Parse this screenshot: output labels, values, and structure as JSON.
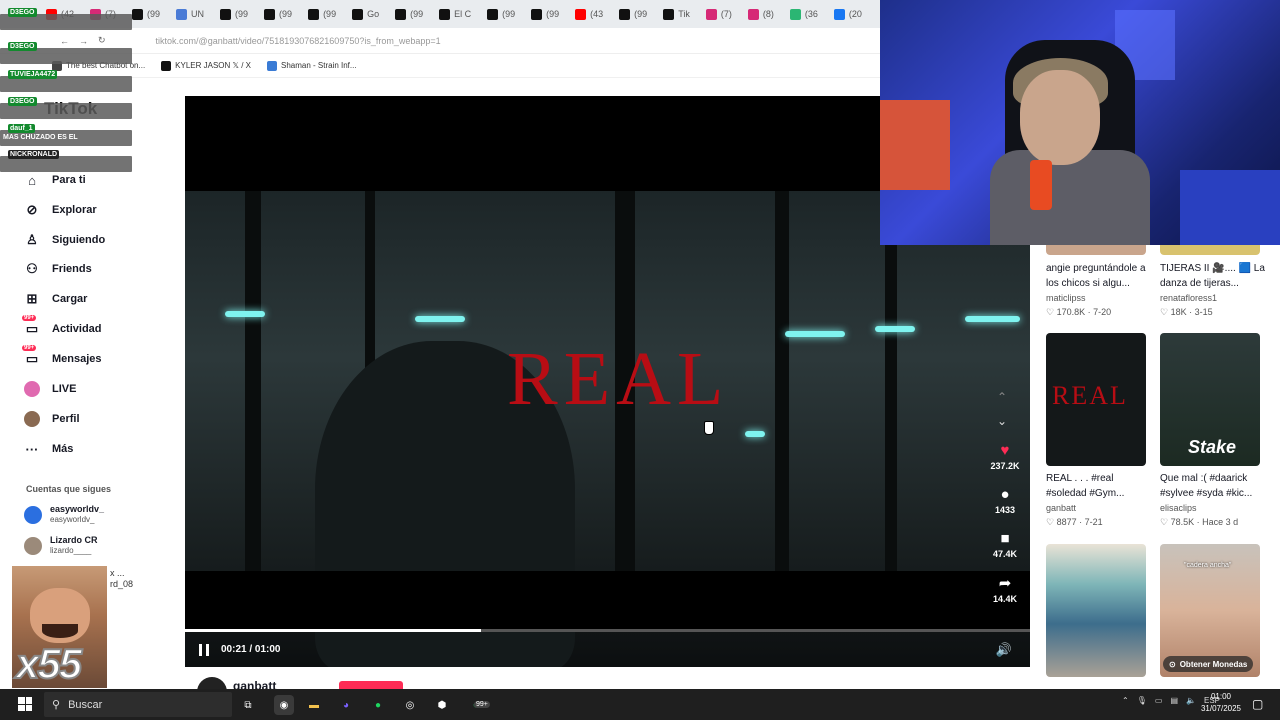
{
  "browser": {
    "tabs": [
      {
        "label": "(42",
        "color": "#ff0000"
      },
      {
        "label": "(7)",
        "color": "#d62976"
      },
      {
        "label": "(99",
        "color": "#111111"
      },
      {
        "label": "UN",
        "color": "#4a7bd6"
      },
      {
        "label": "(99",
        "color": "#111111"
      },
      {
        "label": "(99",
        "color": "#111111"
      },
      {
        "label": "(99",
        "color": "#111111"
      },
      {
        "label": "Go",
        "color": "#111111"
      },
      {
        "label": "(99",
        "color": "#111111"
      },
      {
        "label": "El C",
        "color": "#111111"
      },
      {
        "label": "(99",
        "color": "#111111"
      },
      {
        "label": "(99",
        "color": "#111111"
      },
      {
        "label": "(43",
        "color": "#ff0000"
      },
      {
        "label": "(99",
        "color": "#111111"
      },
      {
        "label": "Tik",
        "color": "#111111"
      },
      {
        "label": "(7)",
        "color": "#d62976"
      },
      {
        "label": "(8)",
        "color": "#d62976"
      },
      {
        "label": "(36",
        "color": "#2bb673"
      },
      {
        "label": "(20",
        "color": "#1877f2"
      }
    ],
    "url": "tiktok.com/@ganbatt/video/7518193076821609750?is_from_webapp=1",
    "bookmarks": [
      {
        "label": "The best Chatbot on...",
        "color": "#444444"
      },
      {
        "label": "KYLER JASON 𝕏 / X",
        "color": "#111111"
      },
      {
        "label": "Shaman - Strain Inf...",
        "color": "#3a7bd5"
      }
    ]
  },
  "chat": [
    {
      "name": "D3EGO",
      "message": ""
    },
    {
      "name": "D3EGO",
      "message": ""
    },
    {
      "name": "TUVIEJA4472",
      "message": ""
    },
    {
      "name": "D3EGO",
      "message": ""
    },
    {
      "name": "dauf_1",
      "message": "MAS CHUZADO ES EL"
    },
    {
      "name": "NICKRONALD",
      "message": ""
    }
  ],
  "sidebar": {
    "logo": "TikTok",
    "items": [
      {
        "label": "Para ti",
        "icon": "home-icon",
        "glyph": "⌂"
      },
      {
        "label": "Explorar",
        "icon": "compass-icon",
        "glyph": "⊘"
      },
      {
        "label": "Siguiendo",
        "icon": "following-icon",
        "glyph": "♙"
      },
      {
        "label": "Friends",
        "icon": "friends-icon",
        "glyph": "⚇"
      },
      {
        "label": "Cargar",
        "icon": "upload-icon",
        "glyph": "⊞"
      },
      {
        "label": "Actividad",
        "icon": "activity-icon",
        "glyph": "",
        "badge": "99+"
      },
      {
        "label": "Mensajes",
        "icon": "messages-icon",
        "glyph": "",
        "badge": "99+"
      },
      {
        "label": "LIVE",
        "icon": "live-icon",
        "glyph": ""
      },
      {
        "label": "Perfil",
        "icon": "profile-icon",
        "glyph": ""
      },
      {
        "label": "Más",
        "icon": "more-icon",
        "glyph": "···"
      }
    ],
    "following_title": "Cuentas que sigues",
    "following": [
      {
        "name": "easyworldv_",
        "user": "easyworldv_",
        "color": "#2b6fe0"
      },
      {
        "name": "Lizardo CR",
        "user": "lizardo____",
        "color": "#9b8a7a"
      }
    ],
    "truncated": [
      "x ...",
      "rd_08"
    ],
    "meme_text": "x55"
  },
  "video": {
    "overlay_text": "REAL",
    "time": "00:21 / 01:00",
    "progress": 0.35,
    "actions": [
      {
        "icon": "heart-icon",
        "glyph": "♥",
        "count": "237.2K",
        "color": "#fe2c55"
      },
      {
        "icon": "comment-icon",
        "glyph": "●",
        "count": "1433",
        "color": "#ffffff"
      },
      {
        "icon": "bookmark-icon",
        "glyph": "■",
        "count": "47.4K",
        "color": "#ffffff"
      },
      {
        "icon": "share-icon",
        "glyph": "➦",
        "count": "14.4K",
        "color": "#ffffff"
      }
    ],
    "author": "ganbatt"
  },
  "recommended": [
    {
      "title": "angie preguntándole a los chicos si algu...",
      "author": "maticlipss",
      "stats": "♡ 170.8K · 7-20"
    },
    {
      "title": "TIJERAS II 🎥.... 🟦 La danza de tijeras...",
      "author": "renatafloress1",
      "stats": "♡ 18K · 3-15"
    },
    {
      "title": "REAL . . . #real #soledad #Gym...",
      "author": "ganbatt",
      "stats": "♡ 8877 · 7-21"
    },
    {
      "title": "Que mal :( #daarick #sylvee #syda #kic...",
      "author": "elisaclips",
      "stats": "♡ 78.5K · Hace 3 d"
    },
    {
      "caption": "\"cadera ancha\""
    }
  ],
  "thumb_texts": {
    "real": "REAL",
    "stake": "Stake"
  },
  "coins_button": "Obtener Monedas",
  "taskbar": {
    "search_placeholder": "Buscar",
    "lang": "ESP",
    "time": "01:00",
    "date": "31/07/2025",
    "whatsapp_badge": "99+"
  },
  "colors": {
    "accent": "#fe2c55",
    "brand": "#161823"
  }
}
